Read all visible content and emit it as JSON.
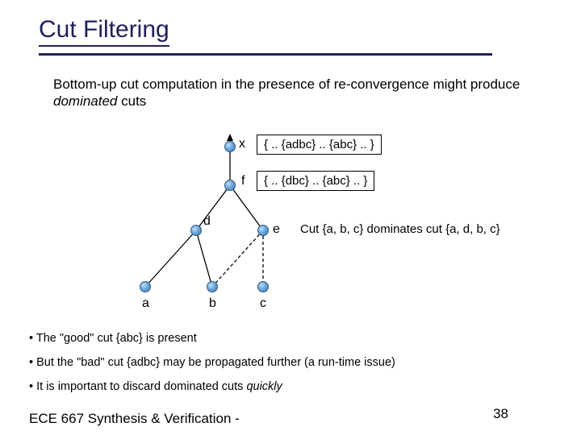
{
  "title": "Cut Filtering",
  "intro_prefix": "Bottom-up cut computation in the presence of re-convergence might produce ",
  "intro_italic": "dominated",
  "intro_suffix": " cuts",
  "nodes": {
    "x": "x",
    "f": "f",
    "d": "d",
    "e": "e",
    "a": "a",
    "b": "b",
    "c": "c"
  },
  "box_x": "{ .. {adbc} .. {abc} .. }",
  "box_f": "{ .. {dbc} .. {abc} .. }",
  "side_note": "Cut {a, b, c} dominates cut {a, d, b, c}",
  "bullets": [
    {
      "pre": "The \"good\" cut {abc} is present",
      "it": "",
      "post": ""
    },
    {
      "pre": "But the \"bad\" cut {adbc} may be propagated further (a run-time issue)",
      "it": "",
      "post": ""
    },
    {
      "pre": "It is important to discard dominated cuts ",
      "it": "quickly",
      "post": ""
    }
  ],
  "footer": "ECE 667 Synthesis & Verification -",
  "pagenum": "38"
}
